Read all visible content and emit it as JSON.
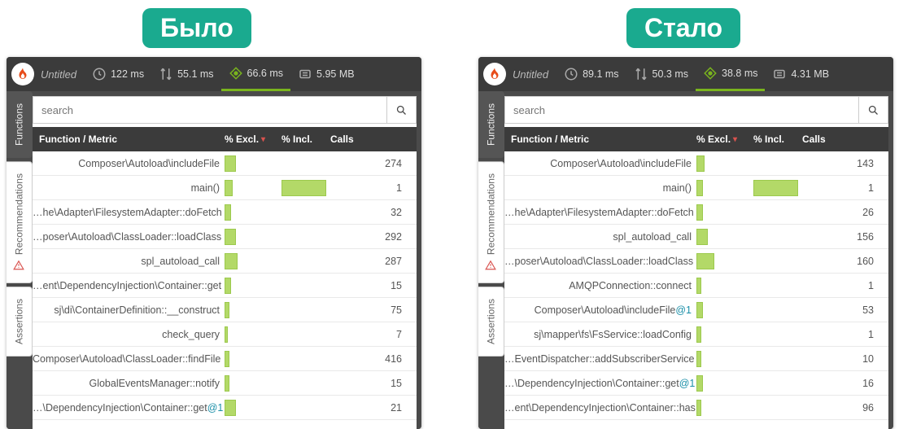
{
  "badges": {
    "left": "Было",
    "right": "Стало"
  },
  "search": {
    "placeholder": "search"
  },
  "headers": {
    "func": "Function / Metric",
    "excl": "% Excl.",
    "incl": "% Incl.",
    "calls": "Calls"
  },
  "side_tabs": {
    "functions": "Functions",
    "recommendations": "Recommendations",
    "assertions": "Assertions"
  },
  "left": {
    "title": "Untitled",
    "metrics": {
      "time": "122 ms",
      "io": "55.1 ms",
      "cpu": "66.6 ms",
      "mem": "5.95 MB"
    },
    "rows": [
      {
        "func": "Composer\\Autoload\\includeFile",
        "excl": 14,
        "incl": 0,
        "calls": "274",
        "at": ""
      },
      {
        "func": "main()",
        "excl": 10,
        "incl": 100,
        "calls": "1",
        "at": ""
      },
      {
        "func": "…he\\Adapter\\FilesystemAdapter::doFetch",
        "excl": 8,
        "incl": 0,
        "calls": "32",
        "at": ""
      },
      {
        "func": "…poser\\Autoload\\ClassLoader::loadClass",
        "excl": 14,
        "incl": 0,
        "calls": "292",
        "at": ""
      },
      {
        "func": "spl_autoload_call",
        "excl": 16,
        "incl": 0,
        "calls": "287",
        "at": ""
      },
      {
        "func": "…ent\\DependencyInjection\\Container::get",
        "excl": 8,
        "incl": 0,
        "calls": "15",
        "at": ""
      },
      {
        "func": "sj\\di\\ContainerDefinition::__construct",
        "excl": 6,
        "incl": 0,
        "calls": "75",
        "at": ""
      },
      {
        "func": "check_query",
        "excl": 4,
        "incl": 0,
        "calls": "7",
        "at": ""
      },
      {
        "func": "Composer\\Autoload\\ClassLoader::findFile",
        "excl": 6,
        "incl": 0,
        "calls": "416",
        "at": ""
      },
      {
        "func": "GlobalEventsManager::notify",
        "excl": 6,
        "incl": 0,
        "calls": "15",
        "at": ""
      },
      {
        "func": "…\\DependencyInjection\\Container::get",
        "excl": 14,
        "incl": 0,
        "calls": "21",
        "at": "@1"
      }
    ]
  },
  "right": {
    "title": "Untitled",
    "metrics": {
      "time": "89.1 ms",
      "io": "50.3 ms",
      "cpu": "38.8 ms",
      "mem": "4.31 MB"
    },
    "rows": [
      {
        "func": "Composer\\Autoload\\includeFile",
        "excl": 10,
        "incl": 0,
        "calls": "143",
        "at": ""
      },
      {
        "func": "main()",
        "excl": 8,
        "incl": 100,
        "calls": "1",
        "at": ""
      },
      {
        "func": "…he\\Adapter\\FilesystemAdapter::doFetch",
        "excl": 8,
        "incl": 0,
        "calls": "26",
        "at": ""
      },
      {
        "func": "spl_autoload_call",
        "excl": 14,
        "incl": 0,
        "calls": "156",
        "at": ""
      },
      {
        "func": "…poser\\Autoload\\ClassLoader::loadClass",
        "excl": 22,
        "incl": 0,
        "calls": "160",
        "at": ""
      },
      {
        "func": "AMQPConnection::connect",
        "excl": 6,
        "incl": 0,
        "calls": "1",
        "at": ""
      },
      {
        "func": "Composer\\Autoload\\includeFile",
        "excl": 8,
        "incl": 0,
        "calls": "53",
        "at": "@1"
      },
      {
        "func": "sj\\mapper\\fs\\FsService::loadConfig",
        "excl": 6,
        "incl": 0,
        "calls": "1",
        "at": ""
      },
      {
        "func": "…EventDispatcher::addSubscriberService",
        "excl": 6,
        "incl": 0,
        "calls": "10",
        "at": ""
      },
      {
        "func": "…\\DependencyInjection\\Container::get",
        "excl": 8,
        "incl": 0,
        "calls": "16",
        "at": "@1"
      },
      {
        "func": "…ent\\DependencyInjection\\Container::has",
        "excl": 6,
        "incl": 0,
        "calls": "96",
        "at": ""
      }
    ]
  }
}
